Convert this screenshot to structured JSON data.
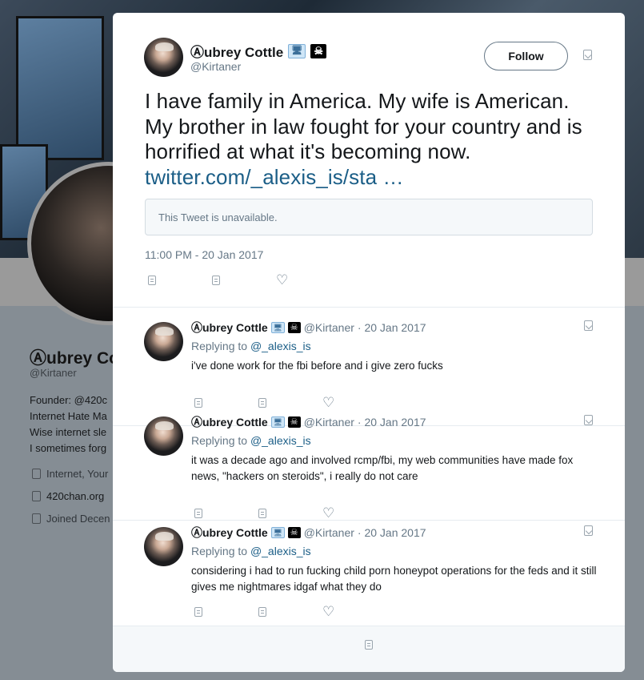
{
  "background_profile": {
    "name": "Ⓐubrey Co",
    "handle": "@Kirtaner",
    "bio_lines": [
      "Founder: @420c",
      "Internet Hate Ma",
      "Wise internet sle",
      "I sometimes forg"
    ],
    "meta": [
      {
        "icon": "location-icon",
        "text": "Internet, Your"
      },
      {
        "icon": "link-icon",
        "text": "420chan.org"
      },
      {
        "icon": "calendar-icon",
        "text": "Joined Decen"
      }
    ]
  },
  "tweet": {
    "author_name": "Ⓐubrey Cottle",
    "author_emojis": [
      "🖥",
      "☠"
    ],
    "author_handle": "@Kirtaner",
    "follow_label": "Follow",
    "text": "I have family in America. My wife is American. My brother in law fought for your country and is horrified at what it's becoming now.",
    "link_text": "twitter.com/_alexis_is/sta …",
    "quoted_unavailable": "This Tweet is unavailable.",
    "timestamp": "11:00 PM - 20 Jan 2017"
  },
  "replies": [
    {
      "name": "Ⓐubrey Cottle",
      "handle": "@Kirtaner",
      "date": "· 20 Jan 2017",
      "replying_prefix": "Replying to",
      "replying_to": "@_alexis_is",
      "text": "i've done work for the fbi before and i give zero fucks"
    },
    {
      "name": "Ⓐubrey Cottle",
      "handle": "@Kirtaner",
      "date": "· 20 Jan 2017",
      "replying_prefix": "Replying to",
      "replying_to": "@_alexis_is",
      "text": "it was a decade ago and involved rcmp/fbi, my web communities have made fox news, \"hackers on steroids\", i really do not care"
    },
    {
      "name": "Ⓐubrey Cottle",
      "handle": "@Kirtaner",
      "date": "· 20 Jan 2017",
      "replying_prefix": "Replying to",
      "replying_to": "@_alexis_is",
      "text": "considering i had to run fucking child porn honeypot operations for the feds and it still gives me nightmares idgaf what they do"
    }
  ],
  "colors": {
    "link": "#1b5e87",
    "secondary_text": "#657786",
    "overlay": "#8a8a8a"
  }
}
